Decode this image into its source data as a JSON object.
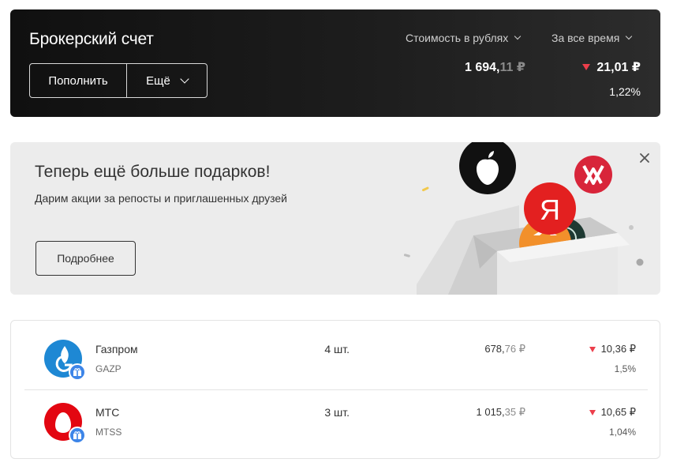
{
  "account": {
    "title": "Брокерский счет",
    "topup_label": "Пополнить",
    "more_label": "Ещё",
    "currency_selector": "Стоимость в рублях",
    "period_selector": "За все время",
    "total_value_int": "1 694,",
    "total_value_frac": "11 ₽",
    "change_abs": "21,01 ₽",
    "change_pct": "1,22%",
    "change_direction": "down",
    "negative_color": "#ec3e4b"
  },
  "promo": {
    "title": "Теперь ещё больше подарков!",
    "subtitle": "Дарим акции за репосты и приглашенных друзей",
    "button_label": "Подробнее",
    "close_icon": "close-icon"
  },
  "portfolio": [
    {
      "name": "Газпром",
      "ticker": "GAZP",
      "quantity": "4 шт.",
      "value_int": "678,",
      "value_frac": "76 ₽",
      "change_abs": "10,36 ₽",
      "change_pct": "1,5%",
      "logo_color": "#1e88d4",
      "logo_icon": "gazprom-logo"
    },
    {
      "name": "МТС",
      "ticker": "MTSS",
      "quantity": "3 шт.",
      "value_int": "1 015,",
      "value_frac": "35 ₽",
      "change_abs": "10,65 ₽",
      "change_pct": "1,04%",
      "logo_color": "#e30611",
      "logo_icon": "mts-logo"
    }
  ]
}
